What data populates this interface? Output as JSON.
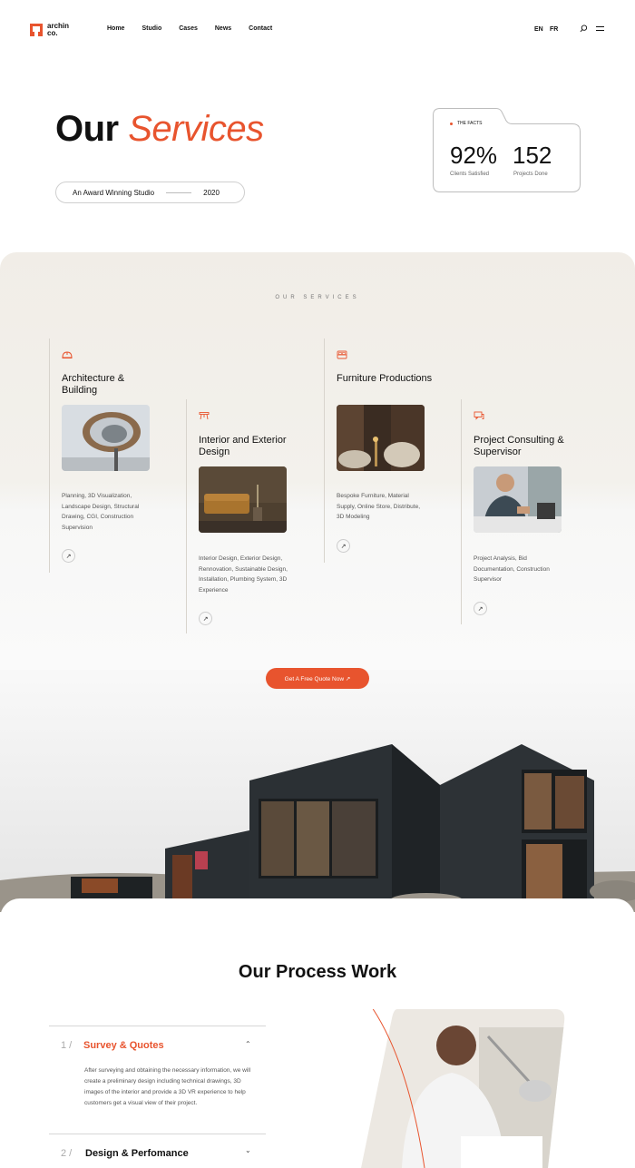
{
  "brand": {
    "name_line1": "archin",
    "name_line2": "co."
  },
  "nav": {
    "items": [
      "Home",
      "Studio",
      "Cases",
      "News",
      "Contact"
    ]
  },
  "lang": {
    "en": "EN",
    "fr": "FR"
  },
  "hero": {
    "title_plain": "Our",
    "title_accent": "Services",
    "pill_text": "An Award Winning Studio",
    "pill_year": "2020"
  },
  "facts": {
    "label": "THE FACTS",
    "stats": [
      {
        "value": "92%",
        "label": "Clients Satisfied"
      },
      {
        "value": "152",
        "label": "Projects Done"
      }
    ]
  },
  "services": {
    "eyebrow": "OUR SERVICES",
    "items": [
      {
        "title": "Architecture & Building",
        "icon": "helmet-icon",
        "desc": "Planning, 3D Visualization, Landscape Design, Structural Drawing, CGI, Construction Supervision"
      },
      {
        "title": "Interior and Exterior Design",
        "icon": "drafting-icon",
        "desc": "Interior Design, Exterior Design, Rennovation, Sustainable Design, Installation, Plumbing System, 3D Experience"
      },
      {
        "title": "Furniture Productions",
        "icon": "bed-icon",
        "desc": "Bespoke Furniture, Material Supply, Online Store, Distribute, 3D Modeling"
      },
      {
        "title": "Project Consulting & Supervisor",
        "icon": "chat-icon",
        "desc": "Project Analysis, Bid Documentation, Construction Supervisor"
      }
    ],
    "cta": "Get A Free Quote Now ↗"
  },
  "process": {
    "title": "Our Process Work",
    "steps": [
      {
        "num": "1 /",
        "title": "Survey & Quotes",
        "expanded": true,
        "body": "After surveying and obtaining the necessary information, we will create a preliminary design including technical drawings, 3D images of the interior and provide a 3D VR experience to help customers get a visual view of their project."
      },
      {
        "num": "2 /",
        "title": "Design & Perfomance",
        "expanded": false
      }
    ]
  },
  "colors": {
    "accent": "#e8542e",
    "text": "#111111",
    "beige": "#f1ede7"
  }
}
